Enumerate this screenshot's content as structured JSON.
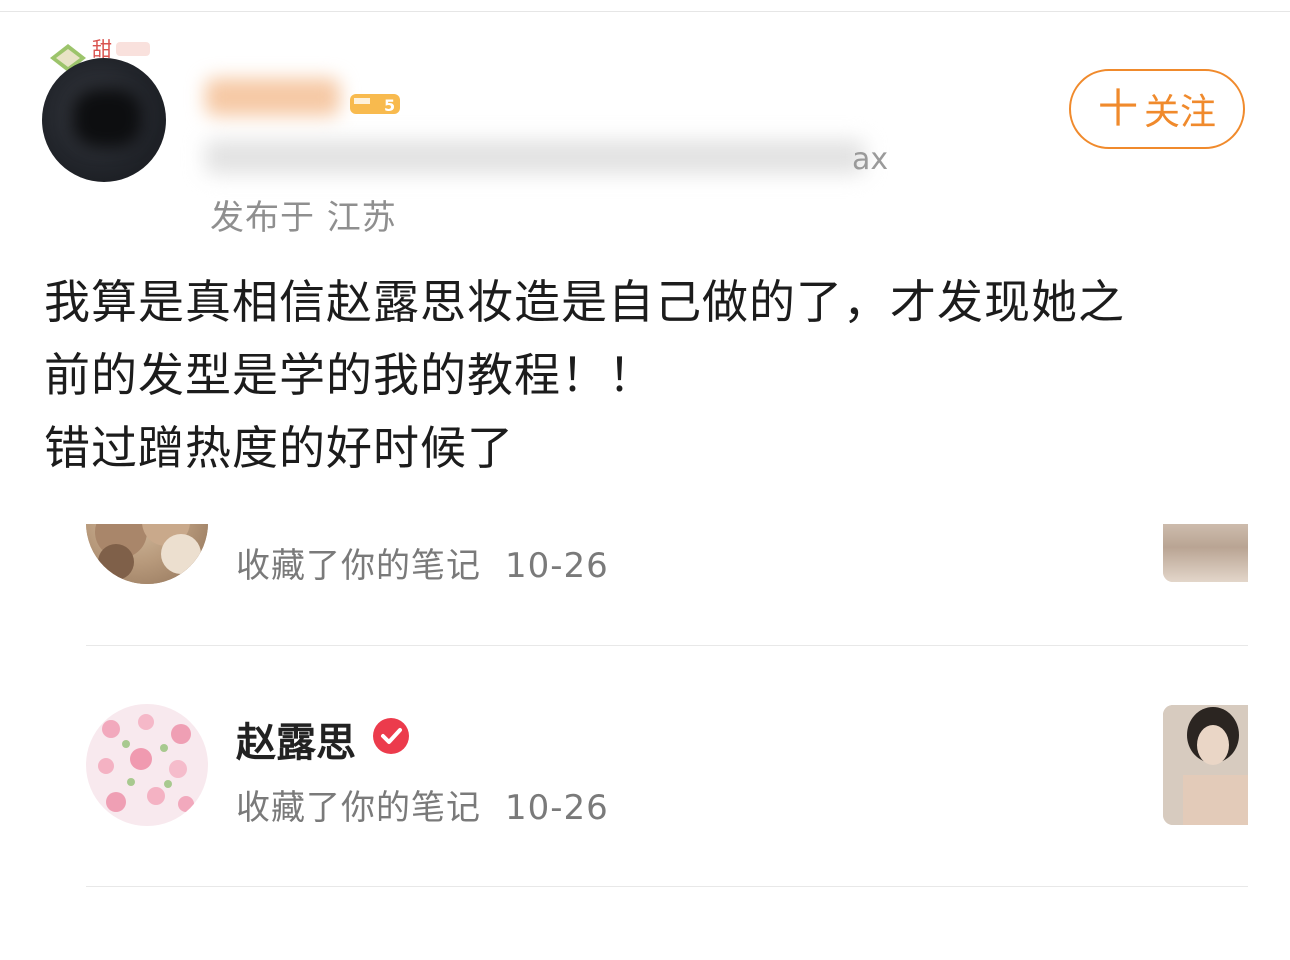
{
  "post": {
    "location": "发布于 江苏",
    "meta_trailing": "ax",
    "follow_label": "关注",
    "follow_plus": "十",
    "content_lines": [
      "我算是真相信赵露思妆造是自己做的了，才发现她之",
      "前的发型是学的我的教程！！",
      "错过蹭热度的好时候了"
    ],
    "badge_text": "甜",
    "vip_text": "5"
  },
  "notifications": [
    {
      "name": "",
      "action": "收藏了你的笔记",
      "time": "10-26",
      "avatar_icon": "teddy-bear-avatar"
    },
    {
      "name": "赵露思",
      "action": "收藏了你的笔记",
      "time": "10-26",
      "avatar_icon": "floral-avatar",
      "verified": true
    }
  ],
  "colors": {
    "accent": "#f08a2c",
    "verified_red": "#ec3b4c",
    "text_secondary": "#7a7a7a"
  }
}
